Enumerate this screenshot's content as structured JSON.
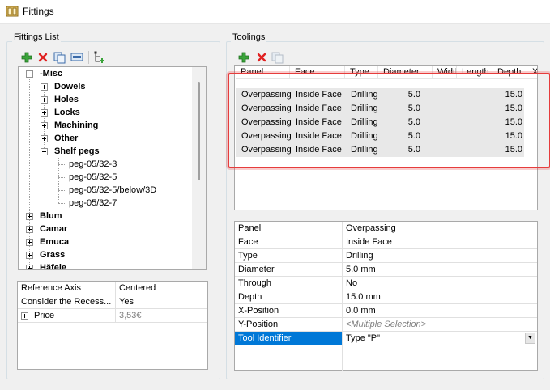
{
  "window": {
    "title": "Fittings"
  },
  "fittings_list": {
    "label": "Fittings List",
    "tree": [
      {
        "label": "-Misc",
        "bold": true,
        "expander": "minus",
        "level": 0
      },
      {
        "label": "Dowels",
        "bold": true,
        "expander": "plus",
        "level": 1
      },
      {
        "label": "Holes",
        "bold": true,
        "expander": "plus",
        "level": 1
      },
      {
        "label": "Locks",
        "bold": true,
        "expander": "plus",
        "level": 1
      },
      {
        "label": "Machining",
        "bold": true,
        "expander": "plus",
        "level": 1
      },
      {
        "label": "Other",
        "bold": true,
        "expander": "plus",
        "level": 1
      },
      {
        "label": "Shelf pegs",
        "bold": true,
        "expander": "minus",
        "level": 1
      },
      {
        "label": "peg-05/32-3",
        "bold": false,
        "expander": "none",
        "level": 2
      },
      {
        "label": "peg-05/32-5",
        "bold": false,
        "expander": "none",
        "level": 2
      },
      {
        "label": "peg-05/32-5/below/3D",
        "bold": false,
        "expander": "none",
        "level": 2
      },
      {
        "label": "peg-05/32-7",
        "bold": false,
        "expander": "none",
        "level": 2
      },
      {
        "label": "Blum",
        "bold": true,
        "expander": "plus",
        "level": 0
      },
      {
        "label": "Camar",
        "bold": true,
        "expander": "plus",
        "level": 0
      },
      {
        "label": "Emuca",
        "bold": true,
        "expander": "plus",
        "level": 0
      },
      {
        "label": "Grass",
        "bold": true,
        "expander": "plus",
        "level": 0
      },
      {
        "label": "Häfele",
        "bold": true,
        "expander": "plus",
        "level": 0
      }
    ],
    "properties": [
      {
        "key": "Reference Axis",
        "value": "Centered",
        "greyed": false,
        "expander": false
      },
      {
        "key": "Consider the Recess...",
        "value": "Yes",
        "greyed": false,
        "expander": false
      },
      {
        "key": "Price",
        "value": "3,53€",
        "greyed": true,
        "expander": true
      }
    ]
  },
  "toolings": {
    "label": "Toolings",
    "columns": [
      "Panel",
      "Face",
      "Type",
      "Diameter",
      "Width",
      "Length",
      "Depth",
      "X"
    ],
    "rows": [
      [
        "Overpassing",
        "Inside Face",
        "Drilling",
        "5.0",
        "",
        "",
        "15.0"
      ],
      [
        "Overpassing",
        "Inside Face",
        "Drilling",
        "5.0",
        "",
        "",
        "15.0"
      ],
      [
        "Overpassing",
        "Inside Face",
        "Drilling",
        "5.0",
        "",
        "",
        "15.0"
      ],
      [
        "Overpassing",
        "Inside Face",
        "Drilling",
        "5.0",
        "",
        "",
        "15.0"
      ],
      [
        "Overpassing",
        "Inside Face",
        "Drilling",
        "5.0",
        "",
        "",
        "15.0"
      ]
    ],
    "properties": [
      {
        "key": "Panel",
        "value": "Overpassing"
      },
      {
        "key": "Face",
        "value": "Inside Face"
      },
      {
        "key": "Type",
        "value": "Drilling"
      },
      {
        "key": "Diameter",
        "value": "5.0 mm"
      },
      {
        "key": "Through",
        "value": "No"
      },
      {
        "key": "Depth",
        "value": "15.0 mm"
      },
      {
        "key": "X-Position",
        "value": "0.0 mm"
      },
      {
        "key": "Y-Position",
        "value": "<Multiple Selection>",
        "italic": true
      },
      {
        "key": "Tool Identifier",
        "value": "Type \"P\"",
        "selected": true,
        "dropdown": true
      }
    ]
  },
  "colors": {
    "selection": "#0078d7",
    "highlight_border": "#e63c3c",
    "add_icon": "#3aa33a",
    "delete_icon": "#e02020",
    "greyed_text": "#808080"
  }
}
